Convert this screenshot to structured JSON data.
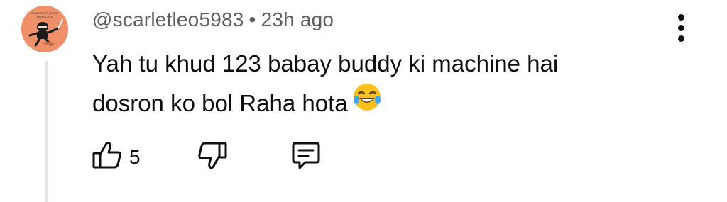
{
  "comment": {
    "author": "@scarletleo5983",
    "separator": "•",
    "time": "23h ago",
    "text_line1": "Yah tu khud 123 babay buddy ki machine hai",
    "text_line2": "dosron ko bol Raha hota",
    "emoji": "face-with-tears-of-joy",
    "like_count": "5",
    "avatar_text": "WHAT GOES IN THE DARK CATS"
  },
  "icons": {
    "like": "thumbs-up-icon",
    "dislike": "thumbs-down-icon",
    "reply": "reply-comment-icon",
    "menu": "more-vertical-icon"
  },
  "colors": {
    "avatar_bg": "#f0906a",
    "meta_text": "#5f5f5f",
    "body_text": "#0f0f0f"
  }
}
